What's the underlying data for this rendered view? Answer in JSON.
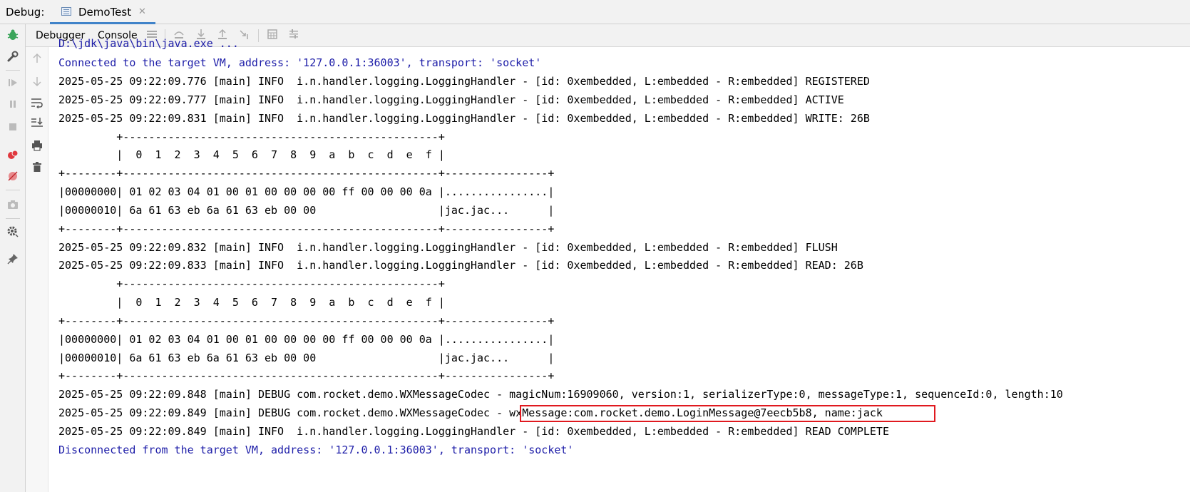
{
  "topbar": {
    "debug_label": "Debug:",
    "tab_title": "DemoTest",
    "tab_close": "✕"
  },
  "toolbar": {
    "tabs": [
      "Debugger",
      "Console"
    ]
  },
  "console": {
    "lines": [
      {
        "text": "D:\\jdk\\java\\bin\\java.exe ...",
        "kind": "sys"
      },
      {
        "text": "Connected to the target VM, address: '127.0.0.1:36003', transport: 'socket'",
        "kind": "sys"
      },
      {
        "text": "2025-05-25 09:22:09.776 [main] INFO  i.n.handler.logging.LoggingHandler - [id: 0xembedded, L:embedded - R:embedded] REGISTERED",
        "kind": "log"
      },
      {
        "text": "2025-05-25 09:22:09.777 [main] INFO  i.n.handler.logging.LoggingHandler - [id: 0xembedded, L:embedded - R:embedded] ACTIVE",
        "kind": "log"
      },
      {
        "text": "2025-05-25 09:22:09.831 [main] INFO  i.n.handler.logging.LoggingHandler - [id: 0xembedded, L:embedded - R:embedded] WRITE: 26B",
        "kind": "log"
      },
      {
        "text": "         +-------------------------------------------------+",
        "kind": "log"
      },
      {
        "text": "         |  0  1  2  3  4  5  6  7  8  9  a  b  c  d  e  f |",
        "kind": "log"
      },
      {
        "text": "+--------+-------------------------------------------------+----------------+",
        "kind": "log"
      },
      {
        "text": "|00000000| 01 02 03 04 01 00 01 00 00 00 00 ff 00 00 00 0a |................|",
        "kind": "log"
      },
      {
        "text": "|00000010| 6a 61 63 eb 6a 61 63 eb 00 00                   |jac.jac...      |",
        "kind": "log"
      },
      {
        "text": "+--------+-------------------------------------------------+----------------+",
        "kind": "log"
      },
      {
        "text": "2025-05-25 09:22:09.832 [main] INFO  i.n.handler.logging.LoggingHandler - [id: 0xembedded, L:embedded - R:embedded] FLUSH",
        "kind": "log"
      },
      {
        "text": "2025-05-25 09:22:09.833 [main] INFO  i.n.handler.logging.LoggingHandler - [id: 0xembedded, L:embedded - R:embedded] READ: 26B",
        "kind": "log"
      },
      {
        "text": "         +-------------------------------------------------+",
        "kind": "log"
      },
      {
        "text": "         |  0  1  2  3  4  5  6  7  8  9  a  b  c  d  e  f |",
        "kind": "log"
      },
      {
        "text": "+--------+-------------------------------------------------+----------------+",
        "kind": "log"
      },
      {
        "text": "|00000000| 01 02 03 04 01 00 01 00 00 00 00 ff 00 00 00 0a |................|",
        "kind": "log"
      },
      {
        "text": "|00000010| 6a 61 63 eb 6a 61 63 eb 00 00                   |jac.jac...      |",
        "kind": "log"
      },
      {
        "text": "+--------+-------------------------------------------------+----------------+",
        "kind": "log"
      },
      {
        "text": "2025-05-25 09:22:09.848 [main] DEBUG com.rocket.demo.WXMessageCodec - magicNum:16909060, version:1, serializerType:0, messageType:1, sequenceId:0, length:10",
        "kind": "log"
      },
      {
        "text": "2025-05-25 09:22:09.849 [main] DEBUG com.rocket.demo.WXMessageCodec - wxMessage:com.rocket.demo.LoginMessage@7eecb5b8, name:jack",
        "kind": "log"
      },
      {
        "text": "2025-05-25 09:22:09.849 [main] INFO  i.n.handler.logging.LoggingHandler - [id: 0xembedded, L:embedded - R:embedded] READ COMPLETE",
        "kind": "log"
      },
      {
        "text": "Disconnected from the target VM, address: '127.0.0.1:36003', transport: 'socket'",
        "kind": "sys"
      }
    ]
  },
  "colors": {
    "system_text": "#1d1da8",
    "highlight_border": "#e0191f",
    "tab_underline": "#4083c9",
    "bug_icon": "#3aa55a",
    "stop_red": "#e0383e"
  }
}
